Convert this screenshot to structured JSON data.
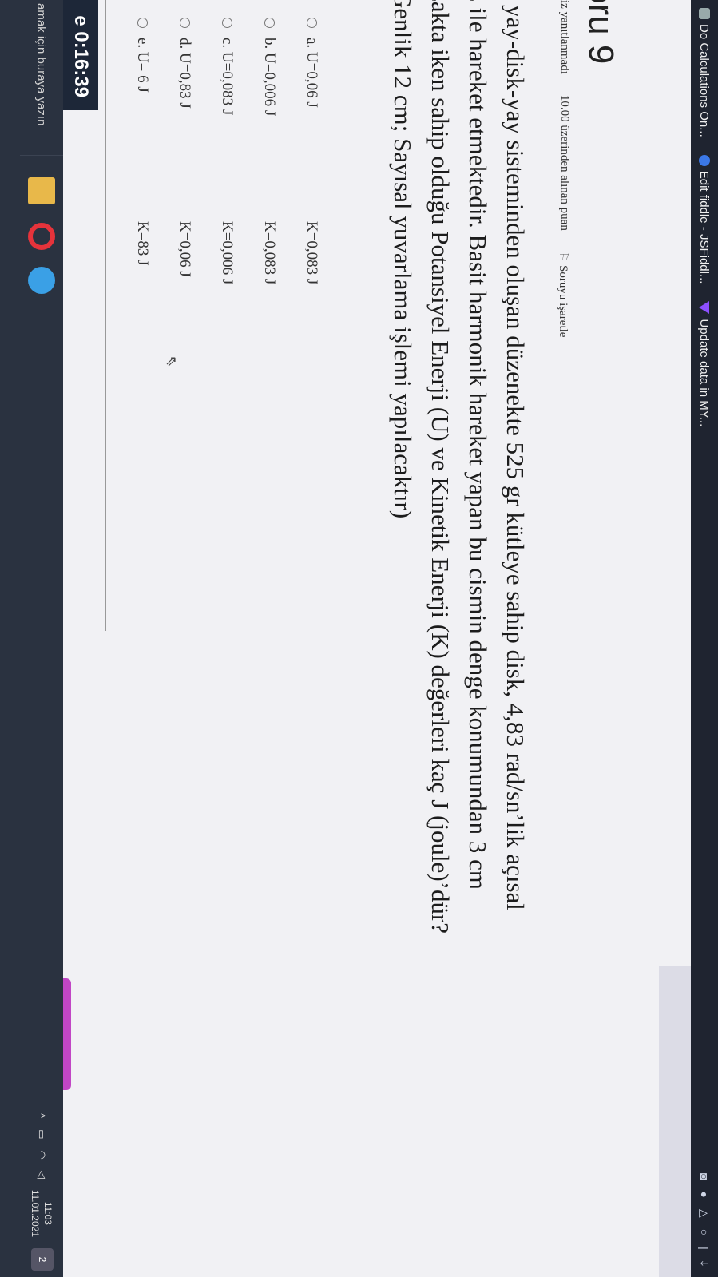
{
  "bookmarks": [
    {
      "label": "Do Calculations On...",
      "icon": "grid-icon"
    },
    {
      "label": "Edit fiddle - JSFiddl...",
      "icon": "jsfiddle-icon"
    },
    {
      "label": "Update data in MY...",
      "icon": "vuetify-icon"
    }
  ],
  "question": {
    "title": "oru 9",
    "status": "iz yanıtlanmadı",
    "points": "10.00 üzerinden alınan puan",
    "flag_label": "Soruyu işaretle",
    "text_lines": [
      "r yay-disk-yay sisteminden oluşan düzenekte 525 gr kütleye sahip disk, 4,83 rad/sn’lik açısal",
      "z ile hareket etmektedir. Basit harmonik hareket yapan bu cismin denge konumundan 3 cm",
      "zakta iken sahip olduğu Potansiyel Enerji (U) ve Kinetik Enerji (K) değerleri kaç J (joule)’dür?",
      "Genlik 12 cm; Sayısal yuvarlama işlemi yapılacaktır)"
    ],
    "answers": [
      {
        "u": "a. U=0,06 J",
        "k": "K=0,083 J"
      },
      {
        "u": "b. U=0,006 J",
        "k": "K=0,083 J"
      },
      {
        "u": "c. U=0,083 J",
        "k": "K=0,006 J"
      },
      {
        "u": "d. U=0,83 J",
        "k": "K=0,06 J"
      },
      {
        "u": "e. U= 6 J",
        "k": "K=83 J"
      }
    ]
  },
  "timer": "e 0:16:39",
  "taskbar": {
    "search_placeholder": "amak için buraya yazın",
    "time": "11:03",
    "date": "11.01.2021",
    "notifications": "2"
  }
}
